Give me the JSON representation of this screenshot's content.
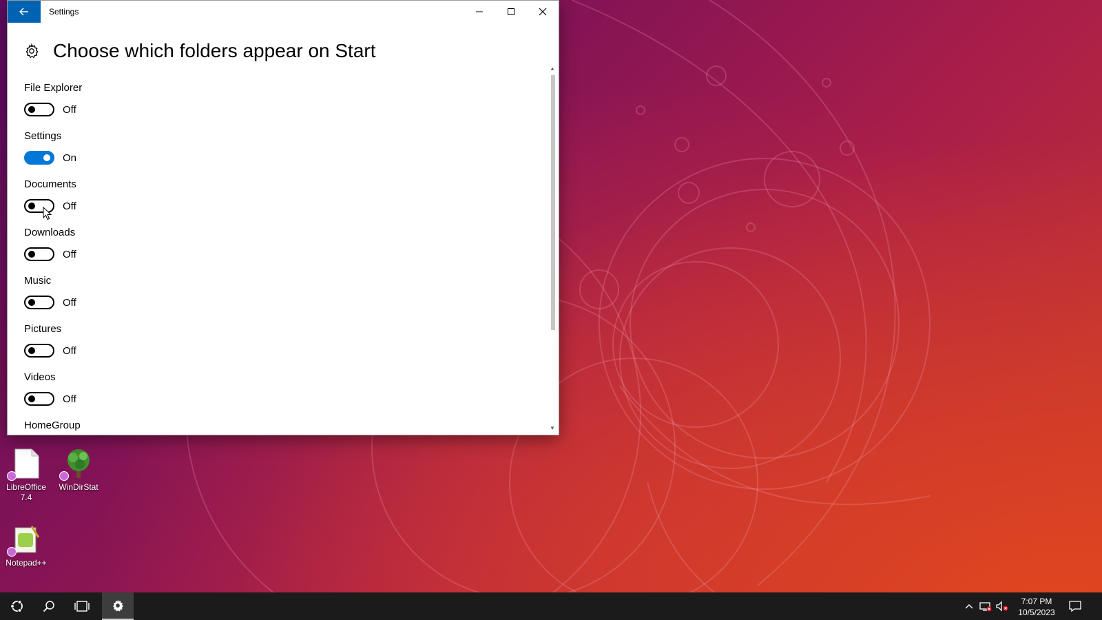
{
  "window": {
    "title": "Settings",
    "page_title": "Choose which folders appear on Start"
  },
  "folders": [
    {
      "label": "File Explorer",
      "state": "Off",
      "on": false
    },
    {
      "label": "Settings",
      "state": "On",
      "on": true
    },
    {
      "label": "Documents",
      "state": "Off",
      "on": false
    },
    {
      "label": "Downloads",
      "state": "Off",
      "on": false
    },
    {
      "label": "Music",
      "state": "Off",
      "on": false
    },
    {
      "label": "Pictures",
      "state": "Off",
      "on": false
    },
    {
      "label": "Videos",
      "state": "Off",
      "on": false
    },
    {
      "label": "HomeGroup"
    }
  ],
  "desktop_icons": [
    {
      "label": "LibreOffice 7.4",
      "icon": "libreoffice-icon"
    },
    {
      "label": "WinDirStat",
      "icon": "windirstat-icon"
    },
    {
      "label": "Notepad++",
      "icon": "notepad-plus-plus-icon"
    }
  ],
  "taskbar": {
    "time": "7:07 PM",
    "date": "10/5/2023",
    "icons": [
      "start-icon",
      "search-icon",
      "task-view-icon",
      "settings-gear-icon"
    ],
    "tray_icons": [
      "chevron-up-icon",
      "network-disconnected-icon",
      "volume-muted-icon",
      "action-center-icon"
    ]
  },
  "colors": {
    "accent": "#0063b1",
    "toggle_on": "#0078d7",
    "taskbar": "#1b1b1b"
  }
}
